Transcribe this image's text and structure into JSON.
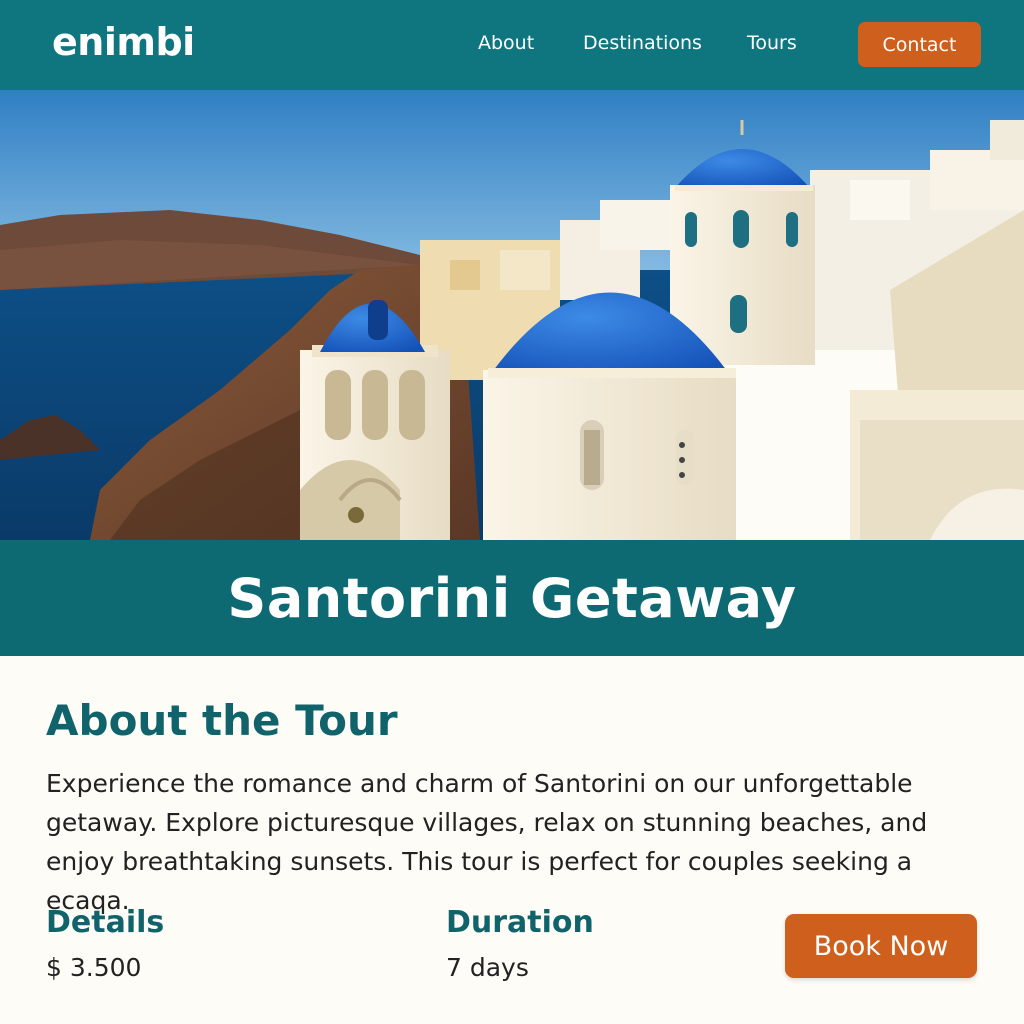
{
  "header": {
    "logo": "enimbi",
    "nav": {
      "about": "About",
      "destinations": "Destinations",
      "tours": "Tours"
    },
    "contact_label": "Contact"
  },
  "hero": {
    "image_alt": "Santorini scenic photo with blue domed churches"
  },
  "title": "Santorini Getaway",
  "about": {
    "heading": "About the Tour",
    "description": "Experience the romance and charm of Santorini on our unforgettable getaway. Explore picturesque villages, relax on stunning beaches, and enjoy breathtaking sunsets. This tour is perfect for couples seeking a ecaqa."
  },
  "details": {
    "label": "Details",
    "price": "$ 3.500"
  },
  "duration": {
    "label": "Duration",
    "value": "7 days"
  },
  "book_label": "Book Now",
  "colors": {
    "primary": "#0f7680",
    "band": "#0d6a73",
    "accent": "#cf5f1c",
    "heading": "#11636b",
    "background": "#fdfcf6"
  }
}
